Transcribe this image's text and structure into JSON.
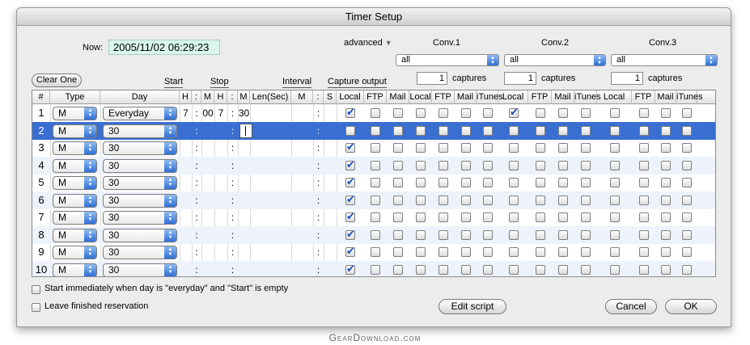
{
  "window": {
    "title": "Timer Setup"
  },
  "now": {
    "label": "Now:",
    "value": "2005/11/02 06:29:23"
  },
  "advanced": {
    "label": "advanced"
  },
  "convs": [
    {
      "title": "Conv.1",
      "select": "all",
      "count": "1",
      "count_label": "captures"
    },
    {
      "title": "Conv.2",
      "select": "all",
      "count": "1",
      "count_label": "captures"
    },
    {
      "title": "Conv.3",
      "select": "all",
      "count": "1",
      "count_label": "captures"
    }
  ],
  "clear_button": "Clear One",
  "groups": {
    "start": "Start",
    "stop": "Stop",
    "interval": "Interval",
    "capture_output": "Capture output"
  },
  "columns": [
    "#",
    "Type",
    "Day",
    "H",
    ":",
    "M",
    "H",
    ":",
    "M",
    "Len(Sec)",
    "M",
    ":",
    "S",
    "Local",
    "FTP",
    "Mail",
    "Local",
    "FTP",
    "Mail",
    "iTunes",
    "Local",
    "FTP",
    "Mail",
    "iTunes",
    "Local",
    "FTP",
    "Mail",
    "iTunes"
  ],
  "rows": [
    {
      "num": "1",
      "type": "M",
      "day": "Everyday",
      "start_h": "7",
      "start_m": "00",
      "stop_h": "7",
      "stop_m": "30",
      "checked": [
        0,
        7
      ]
    },
    {
      "num": "2",
      "type": "M",
      "day": "30",
      "start_h": "",
      "start_m": "",
      "stop_h": "",
      "stop_m": "",
      "checked": []
    },
    {
      "num": "3",
      "type": "M",
      "day": "30",
      "start_h": "",
      "start_m": "",
      "stop_h": "",
      "stop_m": "",
      "checked": [
        0
      ]
    },
    {
      "num": "4",
      "type": "M",
      "day": "30",
      "start_h": "",
      "start_m": "",
      "stop_h": "",
      "stop_m": "",
      "checked": [
        0
      ]
    },
    {
      "num": "5",
      "type": "M",
      "day": "30",
      "start_h": "",
      "start_m": "",
      "stop_h": "",
      "stop_m": "",
      "checked": [
        0
      ]
    },
    {
      "num": "6",
      "type": "M",
      "day": "30",
      "start_h": "",
      "start_m": "",
      "stop_h": "",
      "stop_m": "",
      "checked": [
        0
      ]
    },
    {
      "num": "7",
      "type": "M",
      "day": "30",
      "start_h": "",
      "start_m": "",
      "stop_h": "",
      "stop_m": "",
      "checked": [
        0
      ]
    },
    {
      "num": "8",
      "type": "M",
      "day": "30",
      "start_h": "",
      "start_m": "",
      "stop_h": "",
      "stop_m": "",
      "checked": [
        0
      ]
    },
    {
      "num": "9",
      "type": "M",
      "day": "30",
      "start_h": "",
      "start_m": "",
      "stop_h": "",
      "stop_m": "",
      "checked": [
        0
      ]
    },
    {
      "num": "10",
      "type": "M",
      "day": "30",
      "start_h": "",
      "start_m": "",
      "stop_h": "",
      "stop_m": "",
      "checked": [
        0
      ]
    }
  ],
  "selected_row": "2",
  "options": {
    "start_immediately": "Start immediately when day is \"everyday\" and \"Start\" is empty",
    "leave_finished": "Leave finished reservation"
  },
  "buttons": {
    "edit_script": "Edit script",
    "cancel": "Cancel",
    "ok": "OK"
  },
  "watermark": "GearDownload.com",
  "colors": {
    "selection": "#3a6fd2",
    "alt_row": "#eef2fb",
    "clock_bg": "#d9f5ee",
    "popup_arrow": "#2f6fd6"
  }
}
